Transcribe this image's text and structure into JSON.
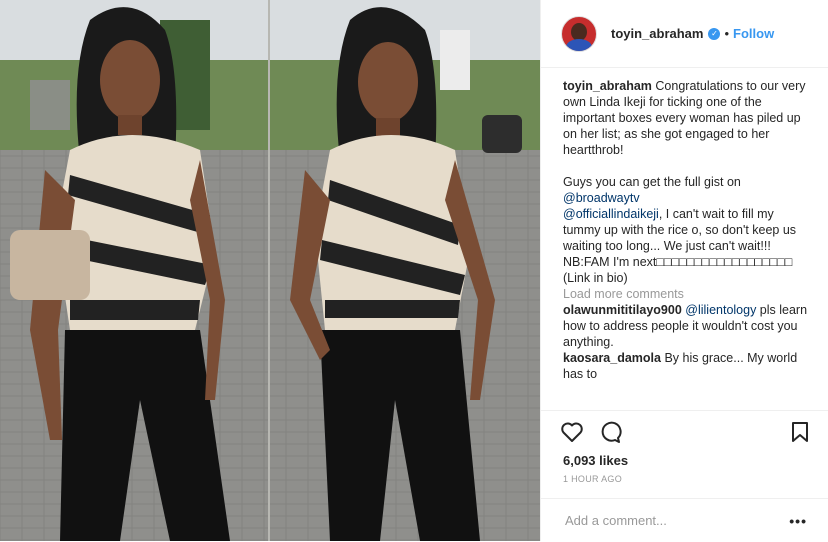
{
  "post": {
    "username": "toyin_abraham",
    "follow_label": "Follow",
    "dot": "•",
    "caption": {
      "username": "toyin_abraham",
      "text1": "Congratulations to our very own Linda Ikeji for ticking one of the important boxes every woman has piled up on her list; as she got engaged to her heartthrob!",
      "text2": "Guys you can get the full gist on",
      "mention1": "@broadwaytv",
      "mention2": "@officiallindaikeji",
      "text3": ", I can't wait to fill my tummy up with the rice o, so don't keep us waiting too long... We just can't wait!!! NB:FAM I'm next□□□□□□□□□□□□□□□□□□",
      "text4": "(Link in bio)"
    },
    "load_more": "Load more comments",
    "comments": [
      {
        "user": "olawunmititilayo900",
        "mention": "@lilientology",
        "text": " pls learn how to address people it wouldn't cost you anything."
      },
      {
        "user": "kaosara_damola",
        "mention": "",
        "text": "By his grace... My world has to"
      }
    ],
    "likes": "6,093 likes",
    "timestamp": "1 HOUR AGO",
    "add_comment_placeholder": "Add a comment...",
    "more_label": "•••"
  },
  "icons": {
    "verified": "verified-badge-icon",
    "like": "heart-icon",
    "comment": "comment-icon",
    "save": "bookmark-icon"
  },
  "colors": {
    "link": "#3897f0",
    "mention": "#003569",
    "muted": "#999999"
  }
}
